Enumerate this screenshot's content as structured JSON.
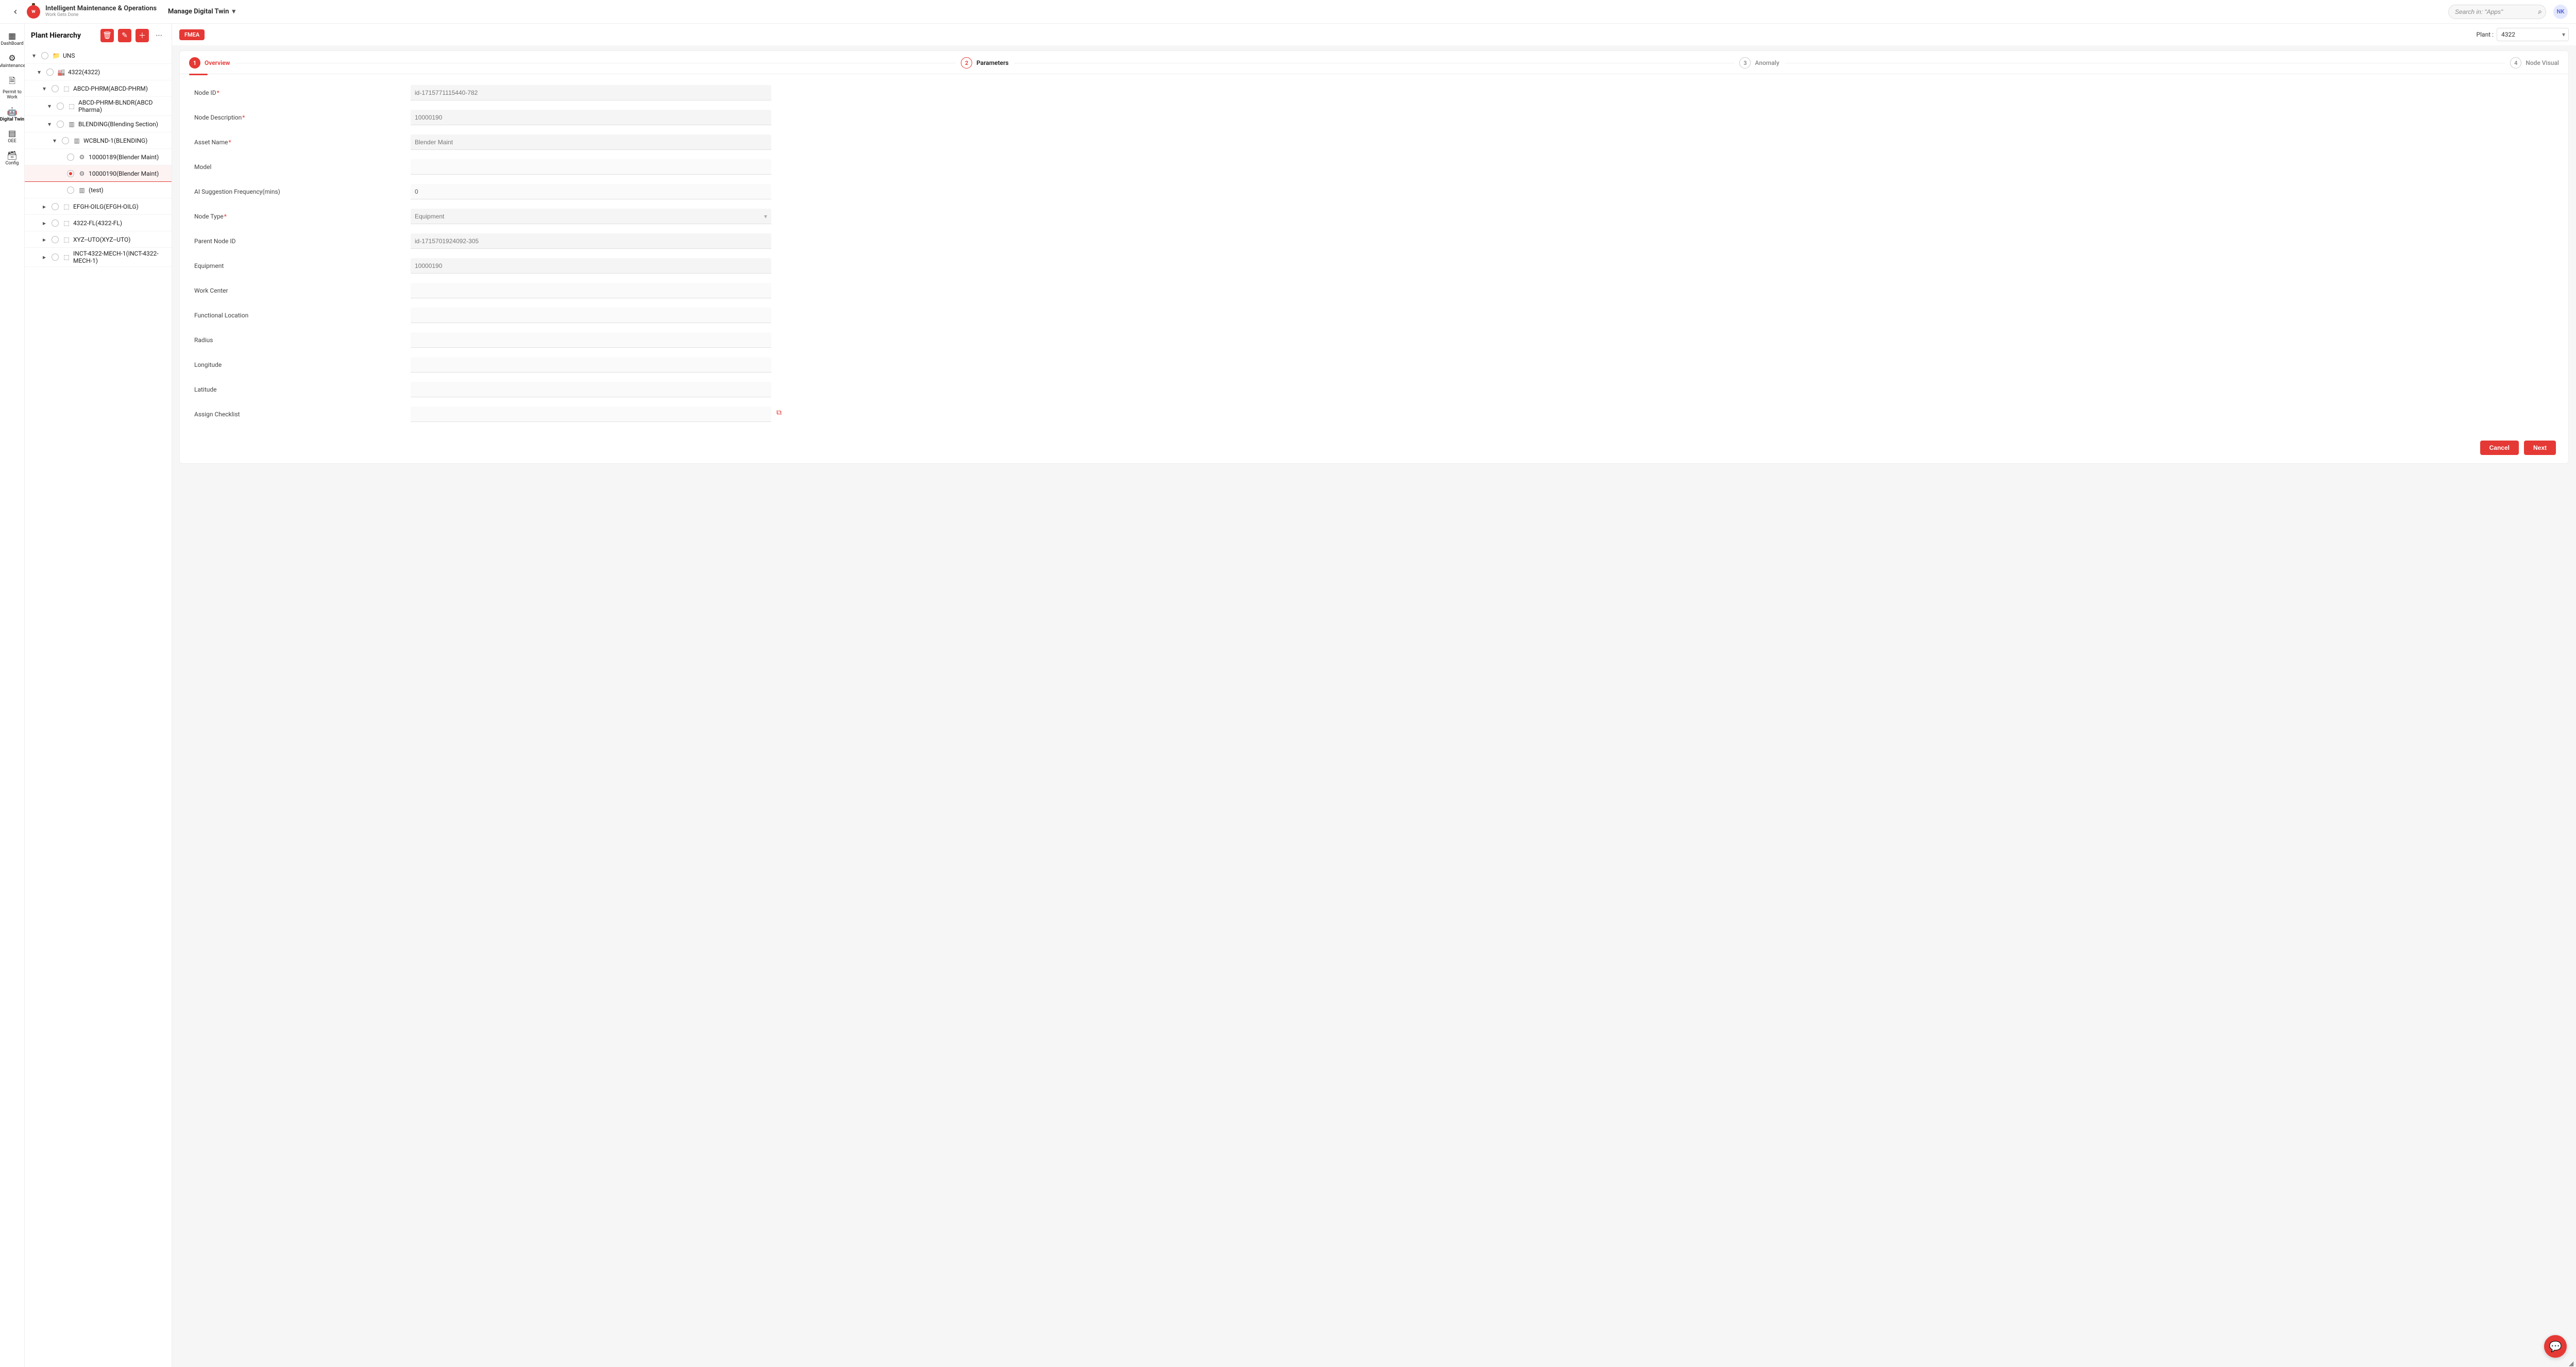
{
  "header": {
    "brand_title": "Intelligent Maintenance & Operations",
    "brand_sub": "Work Gets Done",
    "page_title": "Manage Digital Twin",
    "search_placeholder": "Search in: \"Apps\"",
    "avatar": "NK"
  },
  "rail": [
    {
      "label": "DashBoard",
      "icon": "▦"
    },
    {
      "label": "Maintenance",
      "icon": "⚙"
    },
    {
      "label": "Permit to Work",
      "icon": "🗎"
    },
    {
      "label": "Digital Twin",
      "icon": "🤖"
    },
    {
      "label": "OEE",
      "icon": "▤"
    },
    {
      "label": "Config",
      "icon": "🗃"
    }
  ],
  "ph": {
    "title": "Plant Hierarchy",
    "tree": [
      {
        "pad": 1,
        "tw": "▾",
        "icon": "📁",
        "label": "UNS"
      },
      {
        "pad": 2,
        "tw": "▾",
        "icon": "🏭",
        "label": "4322(4322)"
      },
      {
        "pad": 3,
        "tw": "▾",
        "icon": "⬚",
        "label": "ABCD-PHRM(ABCD-PHRM)"
      },
      {
        "pad": 4,
        "tw": "▾",
        "icon": "⬚",
        "label": "ABCD-PHRM-BLNDR(ABCD Pharma)"
      },
      {
        "pad": 4,
        "tw": "▾",
        "icon": "▥",
        "label": "BLENDING(Blending Section)"
      },
      {
        "pad": 5,
        "tw": "▾",
        "icon": "▥",
        "label": "WCBLND-1(BLENDING)"
      },
      {
        "pad": 6,
        "tw": "",
        "icon": "⚙",
        "label": "10000189(Blender Maint)"
      },
      {
        "pad": 6,
        "tw": "",
        "icon": "⚙",
        "label": "10000190(Blender Maint)",
        "selected": true
      },
      {
        "pad": 6,
        "tw": "",
        "icon": "▥",
        "label": "(test)"
      },
      {
        "pad": 3,
        "tw": "▸",
        "icon": "⬚",
        "label": "EFGH-OILG(EFGH-OILG)"
      },
      {
        "pad": 3,
        "tw": "▸",
        "icon": "⬚",
        "label": "4322-FL(4322-FL)"
      },
      {
        "pad": 3,
        "tw": "▸",
        "icon": "⬚",
        "label": "XYZ--UTO(XYZ--UTO)"
      },
      {
        "pad": 3,
        "tw": "▸",
        "icon": "⬚",
        "label": "INCT-4322-MECH-1(INCT-4322-MECH-1)"
      }
    ]
  },
  "toolbar": {
    "chip": "FMEA",
    "plant_label": "Plant :",
    "plant_value": "4322"
  },
  "stepper": [
    {
      "num": "1",
      "label": "Overview",
      "state": "active"
    },
    {
      "num": "2",
      "label": "Parameters",
      "state": "next"
    },
    {
      "num": "3",
      "label": "Anomaly",
      "state": "muted"
    },
    {
      "num": "4",
      "label": "Node Visual",
      "state": "muted"
    }
  ],
  "form": {
    "node_id_label": "Node ID",
    "node_id": "id-1715771115440-782",
    "node_desc_label": "Node Description",
    "node_desc": "10000190",
    "asset_name_label": "Asset Name",
    "asset_name": "Blender Maint",
    "model_label": "Model",
    "model": "",
    "ai_freq_label": "AI Suggestion Frequency(mins)",
    "ai_freq": "0",
    "node_type_label": "Node Type",
    "node_type": "Equipment",
    "parent_id_label": "Parent Node ID",
    "parent_id": "id-1715701924092-305",
    "equipment_label": "Equipment",
    "equipment": "10000190",
    "work_center_label": "Work Center",
    "work_center": "",
    "func_loc_label": "Functional Location",
    "func_loc": "",
    "radius_label": "Radius",
    "radius": "",
    "longitude_label": "Longitude",
    "longitude": "",
    "latitude_label": "Latitude",
    "latitude": "",
    "assign_cl_label": "Assign Checklist",
    "assign_cl": ""
  },
  "footer": {
    "cancel": "Cancel",
    "next": "Next"
  }
}
